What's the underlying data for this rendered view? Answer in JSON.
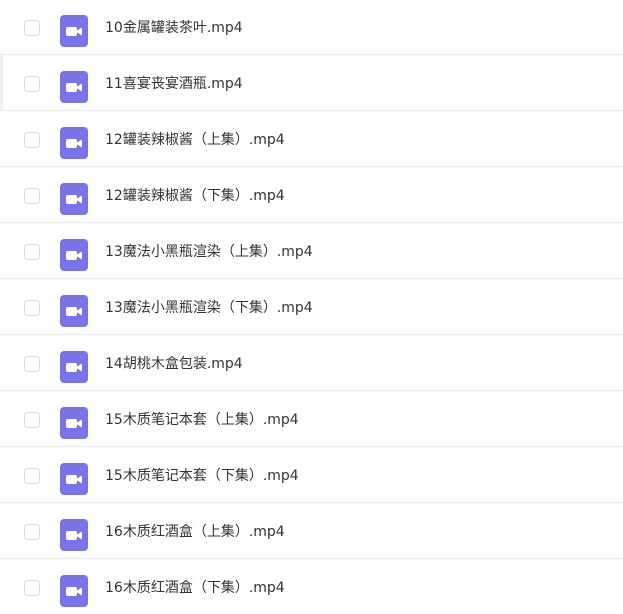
{
  "colors": {
    "icon_background": "#7b74e8",
    "icon_glyph": "#ffffff",
    "file_name_text": "#333333",
    "row_divider": "#ececec",
    "checkbox_border": "#d9d9d9"
  },
  "file_icon": "video-file-icon",
  "files": [
    {
      "name": "10金属罐装茶叶.mp4"
    },
    {
      "name": "11喜宴丧宴酒瓶.mp4"
    },
    {
      "name": "12罐装辣椒酱（上集）.mp4"
    },
    {
      "name": "12罐装辣椒酱（下集）.mp4"
    },
    {
      "name": "13魔法小黑瓶渲染（上集）.mp4"
    },
    {
      "name": "13魔法小黑瓶渲染（下集）.mp4"
    },
    {
      "name": "14胡桃木盒包装.mp4"
    },
    {
      "name": "15木质笔记本套（上集）.mp4"
    },
    {
      "name": "15木质笔记本套（下集）.mp4"
    },
    {
      "name": "16木质红酒盒（上集）.mp4"
    },
    {
      "name": "16木质红酒盒（下集）.mp4"
    }
  ]
}
